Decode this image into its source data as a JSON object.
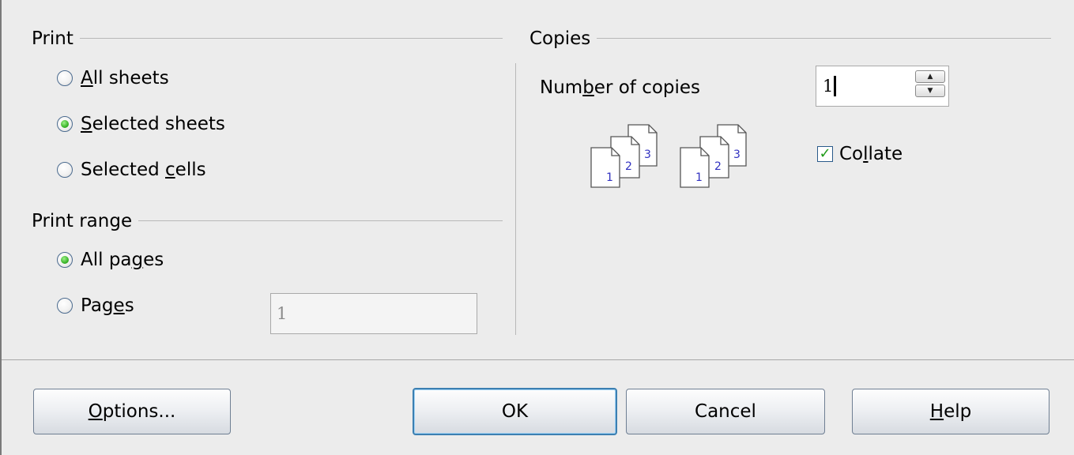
{
  "print_group": {
    "title": "Print",
    "options": [
      {
        "pre": "",
        "mnemonic": "A",
        "post": "ll sheets",
        "checked": false
      },
      {
        "pre": "",
        "mnemonic": "S",
        "post": "elected sheets",
        "checked": true
      },
      {
        "pre": "Selected ",
        "mnemonic": "c",
        "post": "ells",
        "checked": false
      }
    ]
  },
  "range_group": {
    "title": "Print range",
    "options": [
      {
        "pre": "All pa",
        "mnemonic": "g",
        "post": "es",
        "checked": true
      },
      {
        "pre": "Pag",
        "mnemonic": "e",
        "post": "s",
        "checked": false
      }
    ],
    "pages_value": "1"
  },
  "copies_group": {
    "title": "Copies",
    "number_label_pre": "Num",
    "number_label_mnemonic": "b",
    "number_label_post": "er of copies",
    "number_value": "1",
    "collate_pre": "Co",
    "collate_mnemonic": "l",
    "collate_post": "late",
    "collate_checked": true,
    "page_icon_numbers": [
      "1",
      "2",
      "3"
    ]
  },
  "buttons": {
    "options": {
      "pre": "",
      "mnemonic": "O",
      "post": "ptions..."
    },
    "ok": "OK",
    "cancel": "Cancel",
    "help": {
      "pre": "",
      "mnemonic": "H",
      "post": "elp"
    }
  }
}
